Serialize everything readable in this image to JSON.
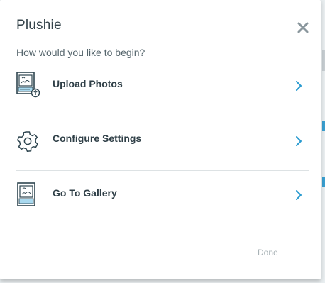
{
  "dialog": {
    "title": "Plushie",
    "subtitle": "How would you like to begin?",
    "close_icon": "close-x-icon",
    "done_label": "Done"
  },
  "options": [
    {
      "label": "Upload Photos",
      "icon": "upload-photo-icon",
      "chevron": "chevron-right-icon"
    },
    {
      "label": "Configure Settings",
      "icon": "gear-icon",
      "chevron": "chevron-right-icon"
    },
    {
      "label": "Go To Gallery",
      "icon": "gallery-icon",
      "chevron": "chevron-right-icon"
    }
  ],
  "colors": {
    "accent": "#2a9bd0",
    "icon_stroke": "#2f4650",
    "icon_blue": "#a9d9ef",
    "done_text": "#a8b2b6"
  }
}
